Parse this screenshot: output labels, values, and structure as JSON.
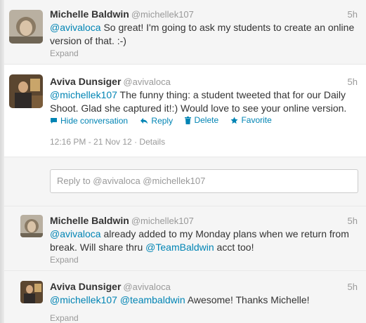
{
  "tweets": [
    {
      "fullname": "Michelle Baldwin",
      "username": "@michellek107",
      "time": "5h",
      "mention": "@avivaloca",
      "text": " So great! I'm going to ask my students to create an online version of that. :-)",
      "expand": "Expand"
    },
    {
      "fullname": "Aviva Dunsiger",
      "username": "@avivaloca",
      "time": "5h",
      "mention": "@michellek107",
      "text": " The funny thing: a student tweeted that for our Daily Shoot. Glad she captured it!:) Would love to see your online version.",
      "actions": {
        "hide": "Hide conversation",
        "reply": "Reply",
        "delete": "Delete",
        "favorite": "Favorite"
      },
      "timestamp": "12:16 PM - 21 Nov 12",
      "details": "Details"
    },
    {
      "fullname": "Michelle Baldwin",
      "username": "@michellek107",
      "time": "5h",
      "mention": "@avivaloca",
      "text1": " already added to my Monday plans when we return from break. Will share thru ",
      "mention2": "@TeamBaldwin",
      "text2": " acct too!",
      "expand": "Expand"
    },
    {
      "fullname": "Aviva Dunsiger",
      "username": "@avivaloca",
      "time": "5h",
      "mention": "@michellek107",
      "mention2": "@teambaldwin",
      "text": " Awesome! Thanks Michelle!",
      "expand": "Expand"
    }
  ],
  "reply_box": {
    "placeholder": "Reply to @avivaloca @michellek107"
  },
  "colors": {
    "link": "#0084b4",
    "muted": "#999999",
    "text": "#333333"
  }
}
